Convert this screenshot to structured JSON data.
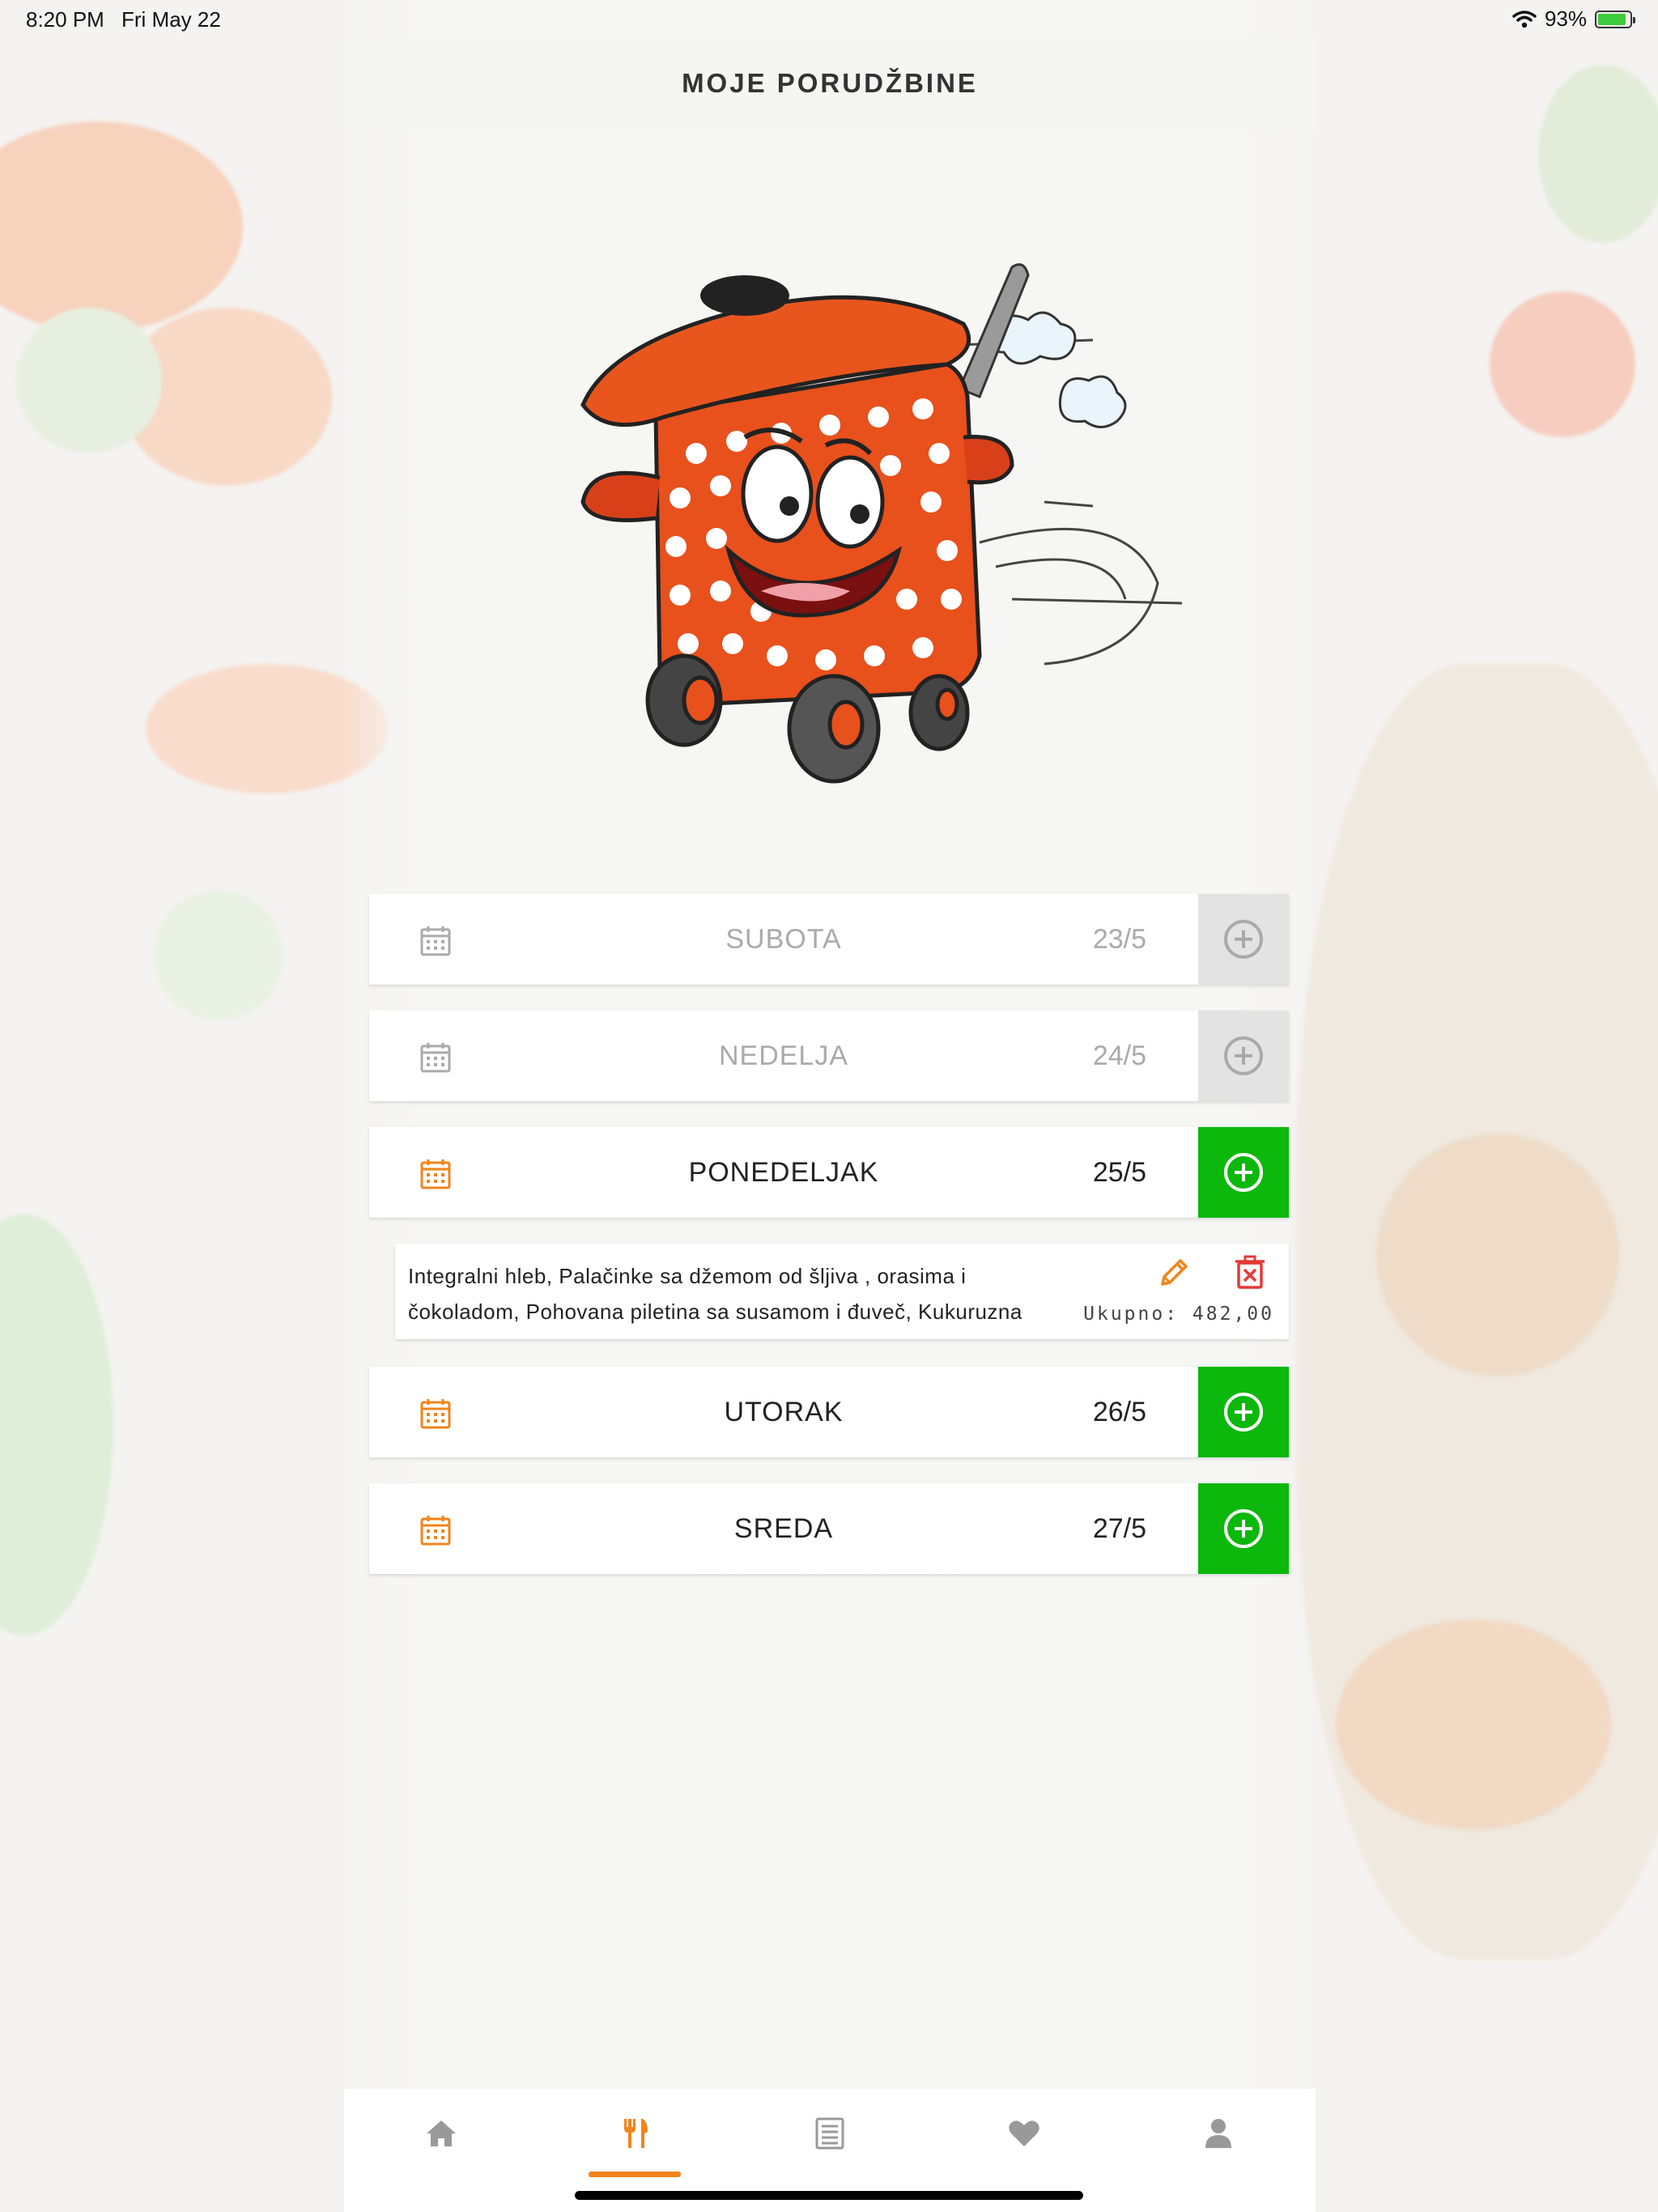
{
  "status_bar": {
    "time": "8:20 PM",
    "date": "Fri May 22",
    "battery": "93%",
    "battery_level": 0.93
  },
  "header": {
    "title": "MOJE PORUDŽBINE"
  },
  "colors": {
    "accent": "#f0841b",
    "green": "#0cb80c",
    "disabled": "#e3e3e3",
    "delete": "#e53935"
  },
  "days": [
    {
      "name": "SUBOTA",
      "date": "23/5",
      "enabled": false
    },
    {
      "name": "NEDELJA",
      "date": "24/5",
      "enabled": false
    },
    {
      "name": "PONEDELJAK",
      "date": "25/5",
      "enabled": true
    },
    {
      "name": "UTORAK",
      "date": "26/5",
      "enabled": true
    },
    {
      "name": "SREDA",
      "date": "27/5",
      "enabled": true
    }
  ],
  "order": {
    "line1": "Integralni hleb, Palačinke sa džemom od šljiva , orasima i",
    "line2": "čokoladom, Pohovana piletina sa susamom i đuveč, Kukuruzna",
    "total": "Ukupno: 482,00"
  },
  "tabs": [
    {
      "icon": "home-icon",
      "active": false
    },
    {
      "icon": "utensils-icon",
      "active": true
    },
    {
      "icon": "list-icon",
      "active": false
    },
    {
      "icon": "heart-icon",
      "active": false
    },
    {
      "icon": "user-icon",
      "active": false
    }
  ]
}
